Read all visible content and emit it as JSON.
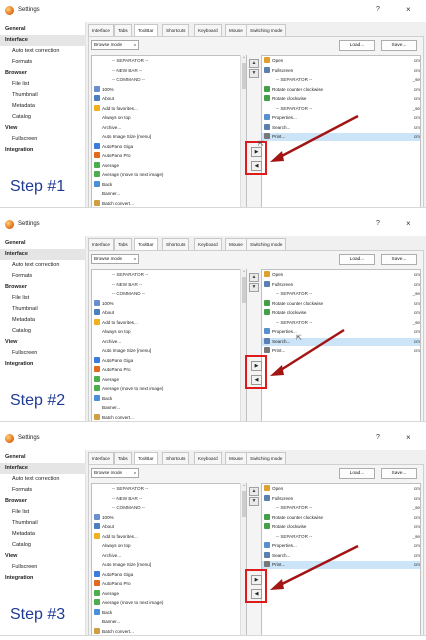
{
  "window": {
    "title": "Settings",
    "help": "?",
    "close": "×"
  },
  "sidebar": [
    {
      "label": "General",
      "kind": "head"
    },
    {
      "label": "Interface",
      "kind": "sel"
    },
    {
      "label": "Auto text correction",
      "kind": "sub"
    },
    {
      "label": "Formats",
      "kind": "sub"
    },
    {
      "label": "Browser",
      "kind": "head"
    },
    {
      "label": "File list",
      "kind": "sub"
    },
    {
      "label": "Thumbnail",
      "kind": "sub"
    },
    {
      "label": "Metadata",
      "kind": "sub"
    },
    {
      "label": "Catalog",
      "kind": "sub"
    },
    {
      "label": "View",
      "kind": "head"
    },
    {
      "label": "Fullscreen",
      "kind": "sub"
    },
    {
      "label": "Integration",
      "kind": "head"
    }
  ],
  "tabs": [
    "Interface",
    "Tabs",
    "ToolBar",
    "Shortcuts",
    "Keyboard",
    "Mouse",
    "Switching mode"
  ],
  "active_tab": "ToolBar",
  "dropdown": {
    "value": "Browse mode",
    "caret": "v"
  },
  "buttons": {
    "load": "Load...",
    "save": "Save..."
  },
  "left_items": [
    {
      "label": "-- SEPARATOR --",
      "icon": "",
      "sep": true
    },
    {
      "label": "-- NEW BAR --",
      "icon": "",
      "sep": true
    },
    {
      "label": "-- COMMAND --",
      "icon": "",
      "sep": true
    },
    {
      "label": "100%",
      "icon": "zoom-icon"
    },
    {
      "label": "About",
      "icon": "info-icon"
    },
    {
      "label": "Add to favorites...",
      "icon": "star-icon"
    },
    {
      "label": "Always on top",
      "icon": ""
    },
    {
      "label": "Archive...",
      "icon": ""
    },
    {
      "label": "Auto Image Size [menu]",
      "icon": ""
    },
    {
      "label": "AutoPano Giga",
      "icon": "autopano-giga-icon"
    },
    {
      "label": "AutoPano Pro",
      "icon": "autopano-pro-icon"
    },
    {
      "label": "Average",
      "icon": "average-icon"
    },
    {
      "label": "Average (move to next image)",
      "icon": "average-icon"
    },
    {
      "label": "Back",
      "icon": "back-icon"
    },
    {
      "label": "Banner...",
      "icon": ""
    },
    {
      "label": "Batch convert...",
      "icon": "batch-icon"
    }
  ],
  "icon_colors": {
    "zoom-icon": "#6a8fd0",
    "info-icon": "#4a7fc1",
    "star-icon": "#f2b01e",
    "autopano-giga-icon": "#3a7be0",
    "autopano-pro-icon": "#e26a1c",
    "average-icon": "#4cae4c",
    "back-icon": "#4a90d9",
    "batch-icon": "#d0a040",
    "open-icon": "#e0a030",
    "fullscreen-icon": "#5a7fb0",
    "rotate-icon": "#43a047",
    "properties-icon": "#5a8fcf",
    "search-icon": "#5b7fae",
    "print-icon": "#777777"
  },
  "panels": [
    {
      "step": "Step #1",
      "right_items": [
        {
          "label": "Open",
          "icon": "open-icon",
          "cmd": "cm"
        },
        {
          "label": "Fullscreen",
          "icon": "fullscreen-icon",
          "cmd": "cm"
        },
        {
          "label": "-- SEPARATOR --",
          "icon": "",
          "cmd": "_se",
          "sep": true
        },
        {
          "label": "Rotate counter clockwise",
          "icon": "rotate-icon",
          "cmd": "cm"
        },
        {
          "label": "Rotate clockwise",
          "icon": "rotate-icon",
          "cmd": "cm"
        },
        {
          "label": "-- SEPARATOR --",
          "icon": "",
          "cmd": "_se",
          "sep": true
        },
        {
          "label": "Properties...",
          "icon": "properties-icon",
          "cmd": "cm"
        },
        {
          "label": "Search...",
          "icon": "search-icon",
          "cmd": "cm"
        },
        {
          "label": "Print...",
          "icon": "print-icon",
          "cmd": "cm",
          "sel": true
        }
      ]
    },
    {
      "step": "Step #2",
      "right_items": [
        {
          "label": "Open",
          "icon": "open-icon",
          "cmd": "cm"
        },
        {
          "label": "Fullscreen",
          "icon": "fullscreen-icon",
          "cmd": "cm"
        },
        {
          "label": "-- SEPARATOR --",
          "icon": "",
          "cmd": "_se",
          "sep": true
        },
        {
          "label": "Rotate counter clockwise",
          "icon": "rotate-icon",
          "cmd": "cm"
        },
        {
          "label": "Rotate clockwise",
          "icon": "rotate-icon",
          "cmd": "cm"
        },
        {
          "label": "-- SEPARATOR --",
          "icon": "",
          "cmd": "_se",
          "sep": true
        },
        {
          "label": "Properties...",
          "icon": "properties-icon",
          "cmd": "cm"
        },
        {
          "label": "Search...",
          "icon": "search-icon",
          "cmd": "cm",
          "sel": true
        },
        {
          "label": "Print...",
          "icon": "print-icon",
          "cmd": "cm"
        }
      ]
    },
    {
      "step": "Step #3",
      "right_items": [
        {
          "label": "Open",
          "icon": "open-icon",
          "cmd": "cm"
        },
        {
          "label": "Fullscreen",
          "icon": "fullscreen-icon",
          "cmd": "cm"
        },
        {
          "label": "-- SEPARATOR --",
          "icon": "",
          "cmd": "_se",
          "sep": true
        },
        {
          "label": "Rotate counter clockwise",
          "icon": "rotate-icon",
          "cmd": "cm"
        },
        {
          "label": "Rotate clockwise",
          "icon": "rotate-icon",
          "cmd": "cm"
        },
        {
          "label": "-- SEPARATOR --",
          "icon": "",
          "cmd": "_se",
          "sep": true
        },
        {
          "label": "Properties...",
          "icon": "properties-icon",
          "cmd": "cm"
        },
        {
          "label": "Search...",
          "icon": "search-icon",
          "cmd": "cm"
        },
        {
          "label": "Print...",
          "icon": "print-icon",
          "cmd": "cm",
          "sel": true
        }
      ]
    }
  ],
  "move_buttons": {
    "up": "▲",
    "down": "▼",
    "add": "▶",
    "remove": "◀"
  },
  "annotation_color": "#a31515",
  "highlight_color": "#e01b1b"
}
